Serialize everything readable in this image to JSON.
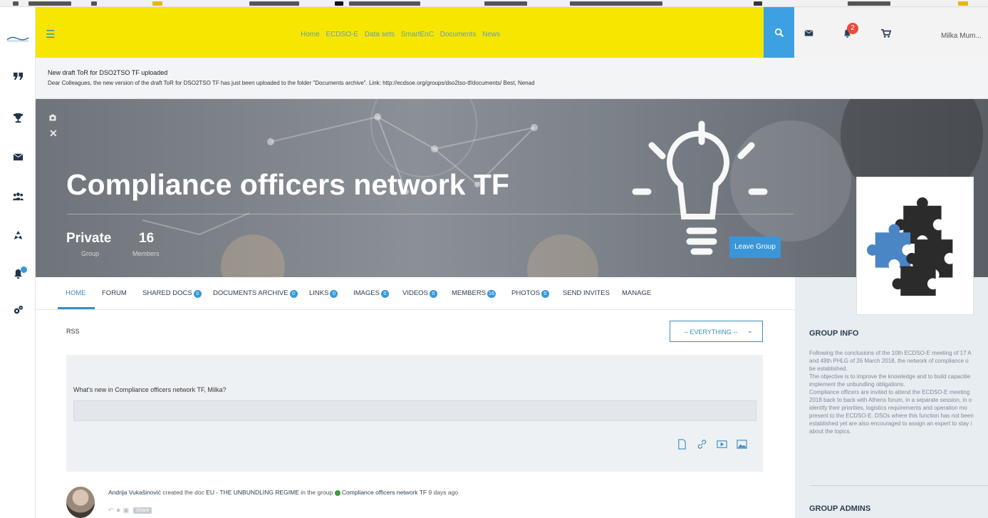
{
  "colors": {
    "topbar_bg": "#f7e600",
    "accent_blue": "#3da0e1",
    "nav_text": "#5c9cce",
    "bell_badge": "#e74c3c",
    "rightpanel_bg": "#e8edf2"
  },
  "sidebar": {
    "items": [
      {
        "icon": "quote-icon"
      },
      {
        "icon": "trophy-icon"
      },
      {
        "icon": "envelope-icon"
      },
      {
        "icon": "users-icon"
      },
      {
        "icon": "recycle-icon"
      },
      {
        "icon": "bell-icon"
      },
      {
        "icon": "cogs-icon"
      }
    ]
  },
  "topbar": {
    "nav": [
      "Home",
      "ECDSO-E",
      "Data sets",
      "SmartEnC",
      "Documents",
      "News"
    ],
    "notifications_count": "2",
    "user_name": "Milka Mum..."
  },
  "notice": {
    "title": "New draft ToR for DSO2TSO TF uploaded",
    "body": "Dear Colleagues, the new version of the draft ToR for DSO2TSO TF has just been uploaded to the folder \"Documents archive\". Link: http://ecdsoe.org/groups/dso2tso-tf/documents/ Best, Nenad"
  },
  "hero": {
    "title": "Compliance officers network TF",
    "status": "Private",
    "status_sub": "Group",
    "members": "16",
    "members_sub": "Members",
    "leave_label": "Leave Group"
  },
  "tabs": [
    {
      "label": "HOME",
      "count": ""
    },
    {
      "label": "FORUM",
      "count": ""
    },
    {
      "label": "SHARED DOCS",
      "count": "0"
    },
    {
      "label": "DOCUMENTS ARCHIVE",
      "count": "0"
    },
    {
      "label": "LINKS",
      "count": "0"
    },
    {
      "label": "IMAGES",
      "count": "0"
    },
    {
      "label": "VIDEOS",
      "count": "0"
    },
    {
      "label": "MEMBERS",
      "count": "16"
    },
    {
      "label": "PHOTOS",
      "count": "0"
    },
    {
      "label": "SEND INVITES",
      "count": ""
    },
    {
      "label": "MANAGE",
      "count": ""
    }
  ],
  "feed": {
    "rss": "RSS",
    "filter": "-- EVERYTHING --",
    "compose_label": "What's new in Compliance officers network TF, Milka?",
    "compose_value": "",
    "activity": {
      "author": "Andrija Vukašinović",
      "verb": " created the doc ",
      "doc": "EU - THE UNBUNDLING REGIME",
      "in_group": " in the group ",
      "group": "Compliance officers network TF",
      "time": " 9 days ago",
      "share": "Share"
    }
  },
  "right_panel": {
    "group_info_title": "GROUP INFO",
    "group_info_lines": [
      "Following the conclusions of the 10th ECDSO-E meeting of 17 A",
      "and 49th PHLG of 26 March 2018, the network of compliance o",
      "be established.",
      "The objective is to improve the knowledge and to build capacitie",
      "implement the unbundling obligations.",
      "Compliance officers are invited to attend the ECDSO-E meeting",
      "2018 back to back with Athens forum, in a separate session, in o",
      "identify their priorities, logistics requirements and operation mo",
      "present to the ECDSO-E. DSOs where this function has not been",
      "established yet are also encouraged to assign an expert to stay i",
      "about the topics."
    ],
    "group_admins_title": "GROUP ADMINS"
  }
}
